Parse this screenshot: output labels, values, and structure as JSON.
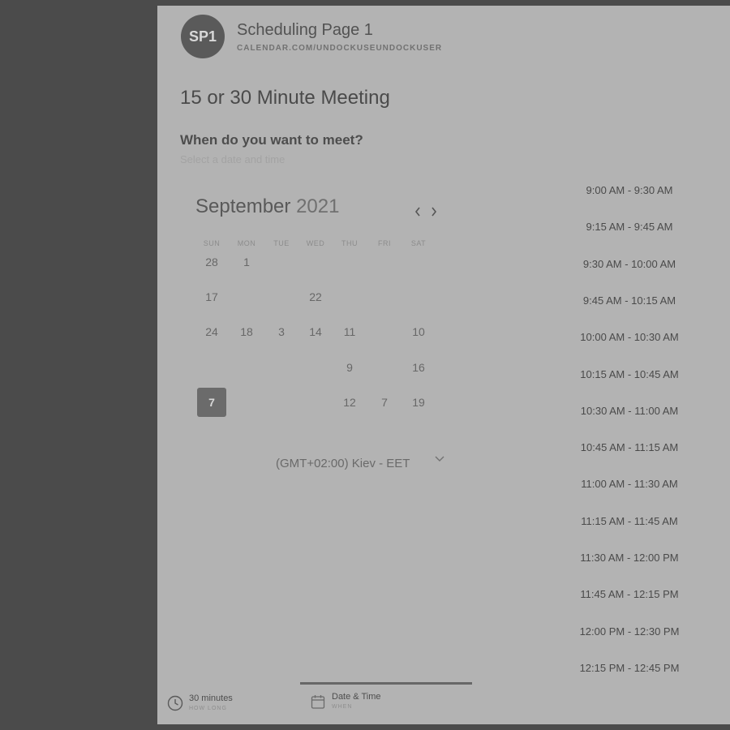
{
  "header": {
    "avatar_initials": "SP1",
    "page_name": "Scheduling Page 1",
    "page_url": "CALENDAR.COM/UNDOCKUSEUNDOCKUSER"
  },
  "meeting": {
    "title": "15 or 30 Minute Meeting",
    "question": "When do you want to meet?",
    "subtitle": "Select a date and time"
  },
  "calendar": {
    "month": "September",
    "year": "2021",
    "prev_icon": "chevron-left-icon",
    "next_icon": "chevron-right-icon",
    "weekdays": [
      "SUN",
      "MON",
      "TUE",
      "WED",
      "THU",
      "FRI",
      "SAT"
    ],
    "weeks": [
      [
        {
          "d": "28"
        },
        {
          "d": "1"
        },
        {
          "d": ""
        },
        {
          "d": ""
        },
        {
          "d": ""
        },
        {
          "d": ""
        },
        {
          "d": ""
        }
      ],
      [
        {
          "d": "17"
        },
        {
          "d": "",
          "faint": true
        },
        {
          "d": ""
        },
        {
          "d": "22"
        },
        {
          "d": "",
          "faint": true
        },
        {
          "d": "",
          "faint": true
        },
        {
          "d": "",
          "faint": true
        }
      ],
      [
        {
          "d": "24"
        },
        {
          "d": "18"
        },
        {
          "d": "3"
        },
        {
          "d": "14"
        },
        {
          "d": "11"
        },
        {
          "d": ""
        },
        {
          "d": "10"
        }
      ],
      [
        {
          "d": "",
          "faint": true
        },
        {
          "d": "",
          "faint": true
        },
        {
          "d": "",
          "faint": true
        },
        {
          "d": "",
          "faint": true
        },
        {
          "d": "9"
        },
        {
          "d": "",
          "faint": true
        },
        {
          "d": "16"
        }
      ],
      [
        {
          "d": "7",
          "selected": true
        },
        {
          "d": ""
        },
        {
          "d": ""
        },
        {
          "d": ""
        },
        {
          "d": "12"
        },
        {
          "d": "7"
        },
        {
          "d": "19"
        }
      ]
    ]
  },
  "timezone": {
    "label": "(GMT+02:00) Kiev - EET",
    "icon": "chevron-down-icon"
  },
  "time_slots": [
    "9:00 AM - 9:30 AM",
    "9:15 AM - 9:45 AM",
    "9:30 AM - 10:00 AM",
    "9:45 AM - 10:15 AM",
    "10:00 AM - 10:30 AM",
    "10:15 AM - 10:45 AM",
    "10:30 AM - 11:00 AM",
    "10:45 AM - 11:15 AM",
    "11:00 AM - 11:30 AM",
    "11:15 AM - 11:45 AM",
    "11:30 AM - 12:00 PM",
    "11:45 AM - 12:15 PM",
    "12:00 PM - 12:30 PM",
    "12:15 PM - 12:45 PM"
  ],
  "steps": {
    "duration": {
      "label": "30 minutes",
      "sublabel": "HOW LONG",
      "icon": "clock-icon"
    },
    "datetime": {
      "label": "Date & Time",
      "sublabel": "WHEN",
      "icon": "calendar-icon"
    }
  },
  "colors": {
    "page_bg": "#4b4b4b",
    "card_bg": "#b3b3b3",
    "selected_day": "#6b6b6b"
  }
}
